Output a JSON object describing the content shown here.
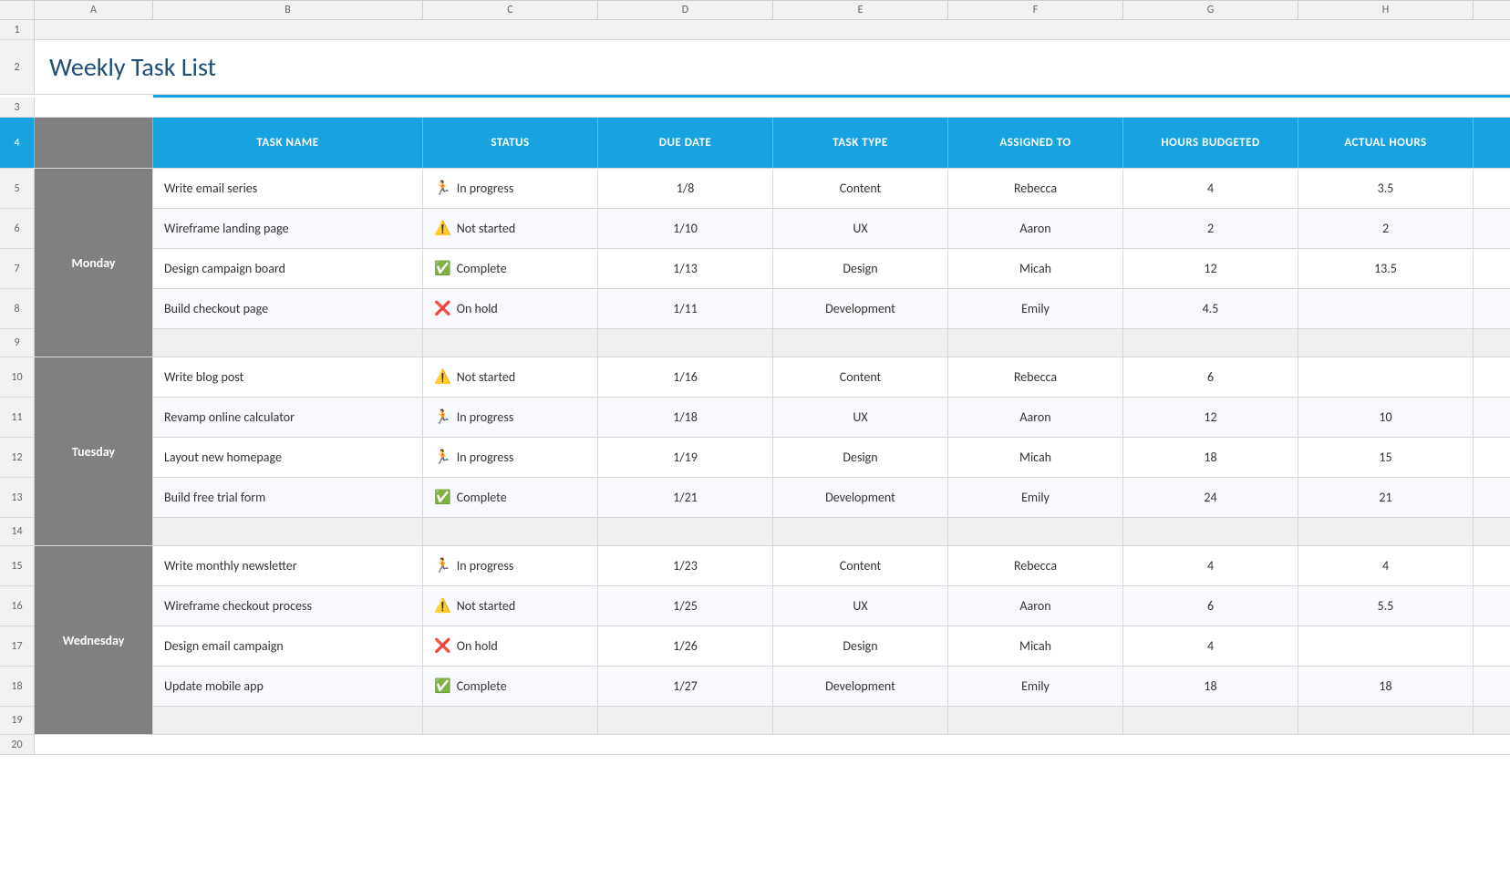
{
  "title": "Weekly Task List",
  "colLetters": [
    "A",
    "B",
    "C",
    "D",
    "E",
    "F",
    "G",
    "H"
  ],
  "rowNums": [
    1,
    2,
    3,
    4,
    5,
    6,
    7,
    8,
    9,
    10,
    11,
    12,
    13,
    14,
    15,
    16,
    17,
    18,
    19
  ],
  "headers": {
    "taskName": "TASK NAME",
    "status": "STATUS",
    "dueDate": "DUE DATE",
    "taskType": "TASK TYPE",
    "assignedTo": "ASSIGNED TO",
    "hoursBudgeted": "HOURS BUDGETED",
    "actualHours": "ACTUAL HOURS"
  },
  "days": [
    {
      "label": "Monday",
      "rows": [
        {
          "task": "Write email series",
          "statusIcon": "🏃",
          "status": "In progress",
          "dueDate": "1/8",
          "taskType": "Content",
          "assignedTo": "Rebecca",
          "hoursBudgeted": "4",
          "actualHours": "3.5"
        },
        {
          "task": "Wireframe landing page",
          "statusIcon": "⚠️",
          "status": "Not started",
          "dueDate": "1/10",
          "taskType": "UX",
          "assignedTo": "Aaron",
          "hoursBudgeted": "2",
          "actualHours": "2"
        },
        {
          "task": "Design campaign board",
          "statusIcon": "✅",
          "status": "Complete",
          "dueDate": "1/13",
          "taskType": "Design",
          "assignedTo": "Micah",
          "hoursBudgeted": "12",
          "actualHours": "13.5"
        },
        {
          "task": "Build checkout page",
          "statusIcon": "❌",
          "status": "On hold",
          "dueDate": "1/11",
          "taskType": "Development",
          "assignedTo": "Emily",
          "hoursBudgeted": "4.5",
          "actualHours": ""
        }
      ]
    },
    {
      "label": "Tuesday",
      "rows": [
        {
          "task": "Write blog post",
          "statusIcon": "⚠️",
          "status": "Not started",
          "dueDate": "1/16",
          "taskType": "Content",
          "assignedTo": "Rebecca",
          "hoursBudgeted": "6",
          "actualHours": ""
        },
        {
          "task": "Revamp online calculator",
          "statusIcon": "🏃",
          "status": "In progress",
          "dueDate": "1/18",
          "taskType": "UX",
          "assignedTo": "Aaron",
          "hoursBudgeted": "12",
          "actualHours": "10"
        },
        {
          "task": "Layout new homepage",
          "statusIcon": "🏃",
          "status": "In progress",
          "dueDate": "1/19",
          "taskType": "Design",
          "assignedTo": "Micah",
          "hoursBudgeted": "18",
          "actualHours": "15"
        },
        {
          "task": "Build free trial form",
          "statusIcon": "✅",
          "status": "Complete",
          "dueDate": "1/21",
          "taskType": "Development",
          "assignedTo": "Emily",
          "hoursBudgeted": "24",
          "actualHours": "21"
        }
      ]
    },
    {
      "label": "Wednesday",
      "rows": [
        {
          "task": "Write monthly newsletter",
          "statusIcon": "🏃",
          "status": "In progress",
          "dueDate": "1/23",
          "taskType": "Content",
          "assignedTo": "Rebecca",
          "hoursBudgeted": "4",
          "actualHours": "4"
        },
        {
          "task": "Wireframe checkout process",
          "statusIcon": "⚠️",
          "status": "Not started",
          "dueDate": "1/25",
          "taskType": "UX",
          "assignedTo": "Aaron",
          "hoursBudgeted": "6",
          "actualHours": "5.5"
        },
        {
          "task": "Design email campaign",
          "statusIcon": "❌",
          "status": "On hold",
          "dueDate": "1/26",
          "taskType": "Design",
          "assignedTo": "Micah",
          "hoursBudgeted": "4",
          "actualHours": ""
        },
        {
          "task": "Update mobile app",
          "statusIcon": "✅",
          "status": "Complete",
          "dueDate": "1/27",
          "taskType": "Development",
          "assignedTo": "Emily",
          "hoursBudgeted": "18",
          "actualHours": "18"
        }
      ]
    }
  ],
  "colors": {
    "headerBg": "#17a3e0",
    "dayBg": "#808080",
    "emptyRowBg": "#d0d0d0",
    "titleColor": "#1f4e79"
  }
}
